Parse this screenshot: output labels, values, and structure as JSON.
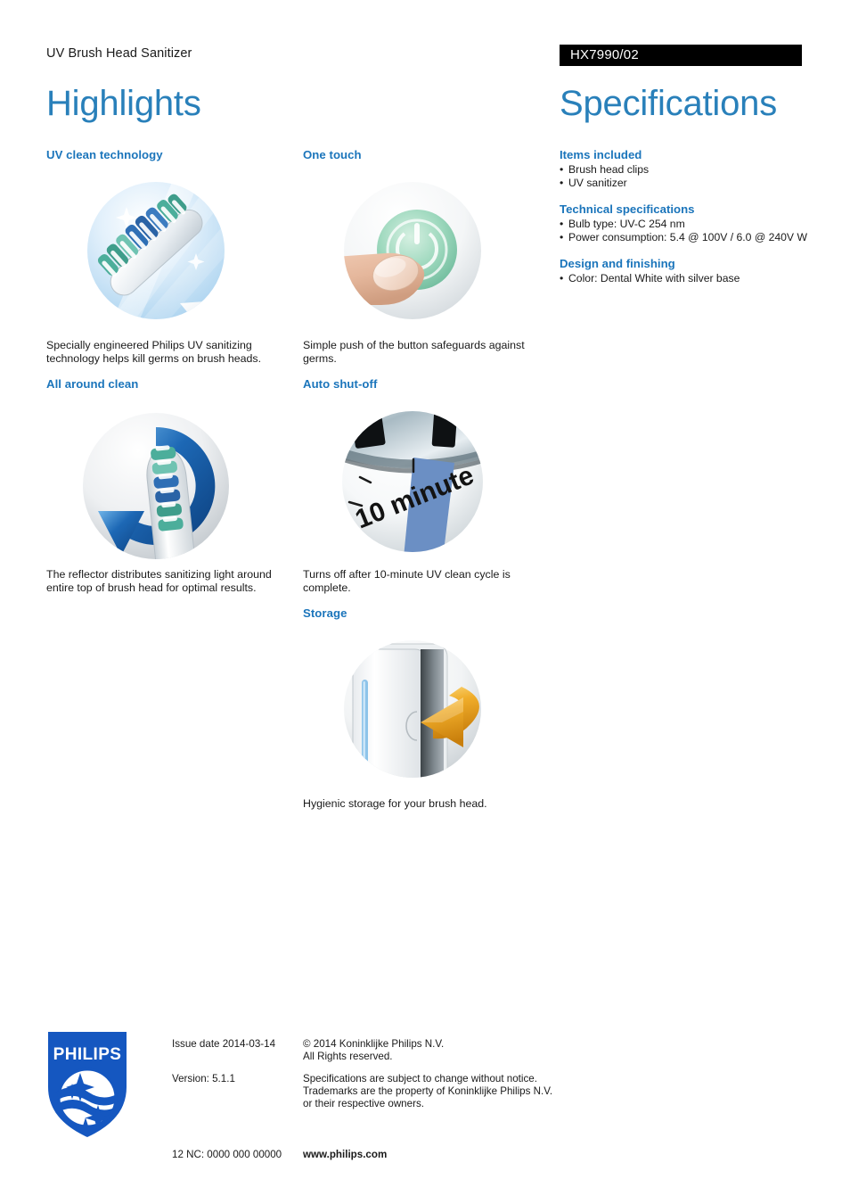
{
  "header": {
    "product_name": "UV Brush Head Sanitizer",
    "model_code": "HX7990/02",
    "highlights_title": "Highlights",
    "specifications_title": "Specifications"
  },
  "highlights": [
    {
      "heading": "UV clean technology",
      "caption": "Specially engineered Philips UV sanitizing technology helps kill germs on brush heads.",
      "image": "toothbrush-head-uv-light-icon"
    },
    {
      "heading": "All around clean",
      "caption": "The reflector distributes sanitizing light around entire top of brush head for optimal results.",
      "image": "toothbrush-rotating-arrow-icon"
    },
    {
      "heading": "One touch",
      "caption": "Simple push of the button safeguards against germs.",
      "image": "finger-pressing-power-button-icon"
    },
    {
      "heading": "Auto shut-off",
      "caption": "Turns off after 10-minute UV clean cycle is complete.",
      "image": "timer-dial-icon",
      "image_label": "10 minute"
    },
    {
      "heading": "Storage",
      "caption": "Hygienic storage for your brush head.",
      "image": "sanitizer-door-arrow-icon"
    }
  ],
  "specifications": [
    {
      "heading": "Items included",
      "items": [
        "Brush head clips",
        "UV sanitizer"
      ]
    },
    {
      "heading": "Technical specifications",
      "items": [
        "Bulb type: UV-C 254 nm",
        "Power consumption: 5.4 @ 100V / 6.0 @ 240V W"
      ]
    },
    {
      "heading": "Design and finishing",
      "items": [
        "Color: Dental White with silver base"
      ]
    }
  ],
  "footer": {
    "logo_wordmark": "PHILIPS",
    "issue_date": "Issue date 2014-03-14",
    "version": "Version: 5.1.1",
    "twelve_nc": "12 NC: 0000 000 00000",
    "copyright_line1": "© 2014 Koninklijke Philips N.V.",
    "copyright_line2": "All Rights reserved.",
    "disclaimer_line1": "Specifications are subject to change without notice.",
    "disclaimer_line2": "Trademarks are the property of Koninklijke Philips N.V.",
    "disclaimer_line3": "or their respective owners.",
    "website": "www.philips.com"
  },
  "colors": {
    "title_blue": "#2980ba",
    "heading_blue": "#1b75bb",
    "logo_blue": "#1557c0",
    "bar_black": "#000000",
    "timer_wedge_blue": "#6b8fc4",
    "arrow_orange": "#e8a317",
    "bristle_teal": "#4cae9b",
    "bristle_blue": "#2f6fb5"
  }
}
